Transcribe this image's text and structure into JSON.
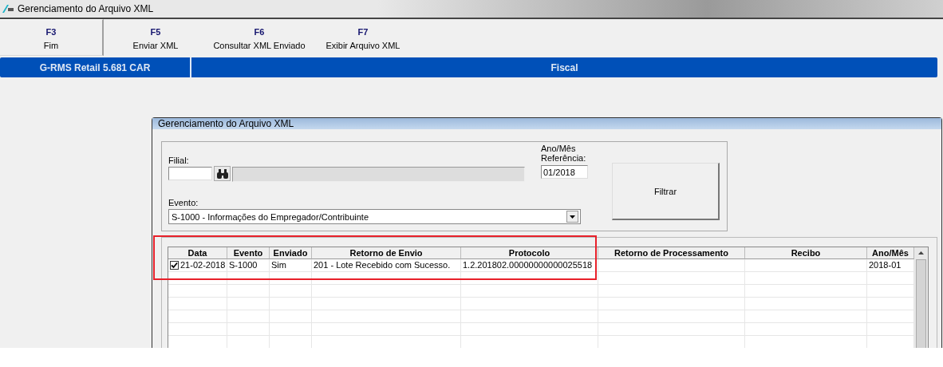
{
  "window": {
    "title": "Gerenciamento do Arquivo XML"
  },
  "toolbar": [
    {
      "key": "F3",
      "label": "Fim",
      "selected": true
    },
    {
      "key": "F5",
      "label": "Enviar XML",
      "selected": false
    },
    {
      "key": "F6",
      "label": "Consultar XML Enviado",
      "selected": false
    },
    {
      "key": "F7",
      "label": "Exibir Arquivo XML",
      "selected": false
    }
  ],
  "info_bar": {
    "version": "G-RMS Retail 5.681 CAR",
    "module": "Fiscal"
  },
  "dialog": {
    "title": "Gerenciamento do Arquivo XML",
    "filial_label": "Filial:",
    "ano_mes_label": "Ano/Mês Referência:",
    "ano_mes_value": "01/2018",
    "evento_label": "Evento:",
    "evento_value": "S-1000 - Informações do Empregador/Contribuinte",
    "filter_button": "Filtrar",
    "table": {
      "columns": [
        "Data",
        "Evento",
        "Enviado",
        "Retorno de Envio",
        "Protocolo",
        "Retorno de Processamento",
        "Recibo",
        "Ano/Mês"
      ],
      "rows": [
        {
          "checked": true,
          "cells": [
            "21-02-2018",
            "S-1000",
            "Sim",
            "201 - Lote Recebido com Sucesso.",
            "1.2.201802.00000000000025518",
            null,
            null,
            "2018-01"
          ]
        }
      ]
    }
  }
}
